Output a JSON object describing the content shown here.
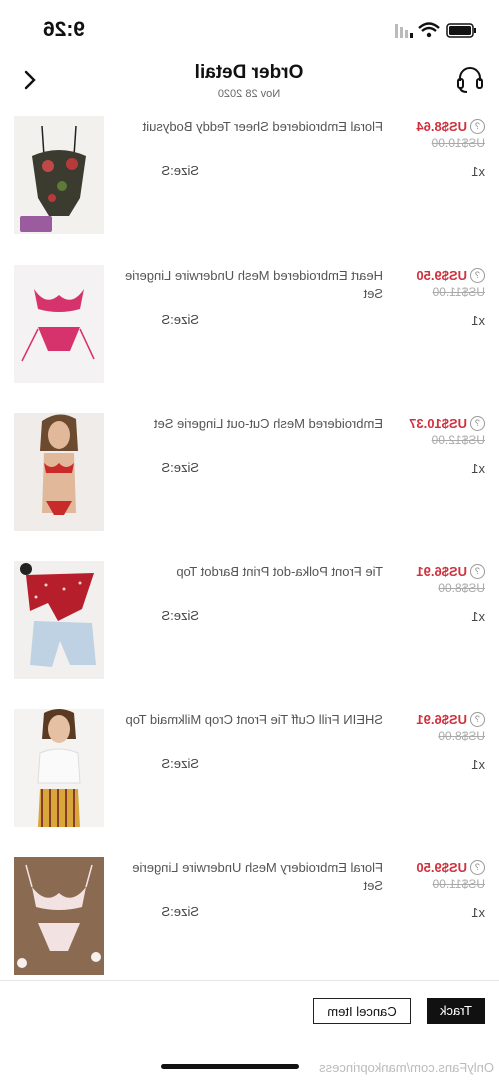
{
  "status_bar": {
    "time": "9:26"
  },
  "header": {
    "title": "Order Detail",
    "date": "Nov 28 2020"
  },
  "items": [
    {
      "name": "Floral Embroidered Sheer Teddy Bodysuit",
      "price": "US$8.64",
      "original_price": "US$10.00",
      "size": "Size:S",
      "qty": "x1"
    },
    {
      "name": "Heart Embroidered Mesh Underwire Lingerie Set",
      "price": "US$9.50",
      "original_price": "US$11.00",
      "size": "Size:S",
      "qty": "x1"
    },
    {
      "name": "Embroidered Mesh Cut-out Lingerie Set",
      "price": "US$10.37",
      "original_price": "US$12.00",
      "size": "Size:S",
      "qty": "x1"
    },
    {
      "name": "Tie Front Polka-dot Print Bardot Top",
      "price": "US$6.91",
      "original_price": "US$8.00",
      "size": "Size:S",
      "qty": "x1"
    },
    {
      "name": "SHEIN Frill Cuff Tie Front Crop Milkmaid Top",
      "price": "US$6.91",
      "original_price": "US$8.00",
      "size": "Size:S",
      "qty": "x1"
    },
    {
      "name": "Floral Embroidery Mesh Underwire Lingerie Set",
      "price": "US$9.50",
      "original_price": "US$11.00",
      "size": "Size:S",
      "qty": "x1"
    }
  ],
  "actions": {
    "cancel": "Cancel Item",
    "track": "Track"
  },
  "watermark": "OnlyFans.com/mankoprincess",
  "colors": {
    "price": "#d0303c",
    "primary_button": "#111111"
  }
}
